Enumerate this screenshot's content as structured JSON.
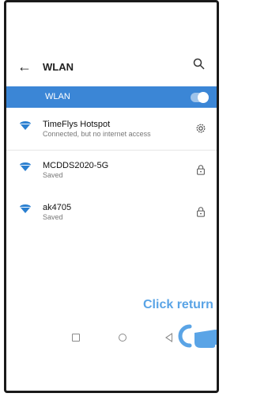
{
  "header": {
    "title": "WLAN"
  },
  "wlan_toggle": {
    "label": "WLAN",
    "state": "on"
  },
  "networks": [
    {
      "name": "TimeFlys Hotspot",
      "status": "Connected, but no internet access",
      "trailing_icon": "gear-icon"
    },
    {
      "name": "MCDDS2020-5G",
      "status": "Saved",
      "trailing_icon": "lock-icon"
    },
    {
      "name": "ak4705",
      "status": "Saved",
      "trailing_icon": "lock-icon"
    }
  ],
  "hint": {
    "text": "Click return"
  },
  "colors": {
    "accent": "#3b86d6",
    "hint": "#5aa4e6",
    "wifi": "#2a7fd0"
  }
}
